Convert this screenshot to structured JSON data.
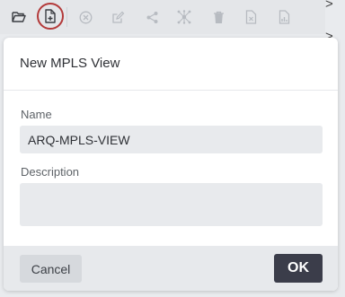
{
  "toolbar": {
    "buttons": [
      {
        "icon": "folder-open-icon"
      },
      {
        "icon": "new-file-icon"
      },
      {
        "icon": "close-circle-icon"
      },
      {
        "icon": "edit-icon"
      },
      {
        "icon": "share-icon"
      },
      {
        "icon": "network-icon"
      },
      {
        "icon": "trash-icon"
      },
      {
        "icon": "file-remove-icon"
      },
      {
        "icon": "file-chart-icon"
      }
    ],
    "highlight_color": "#b33a3a"
  },
  "dialog": {
    "title": "New MPLS View",
    "name_label": "Name",
    "name_value": "ARQ-MPLS-VIEW",
    "description_label": "Description",
    "description_value": "",
    "cancel_label": "Cancel",
    "ok_label": "OK"
  },
  "side": {
    "items": [
      ">",
      ">",
      "+"
    ]
  },
  "colors": {
    "ok_bg": "#3b3d4a",
    "footer_bg": "#e7e9ec",
    "input_bg": "#e8eaed"
  }
}
